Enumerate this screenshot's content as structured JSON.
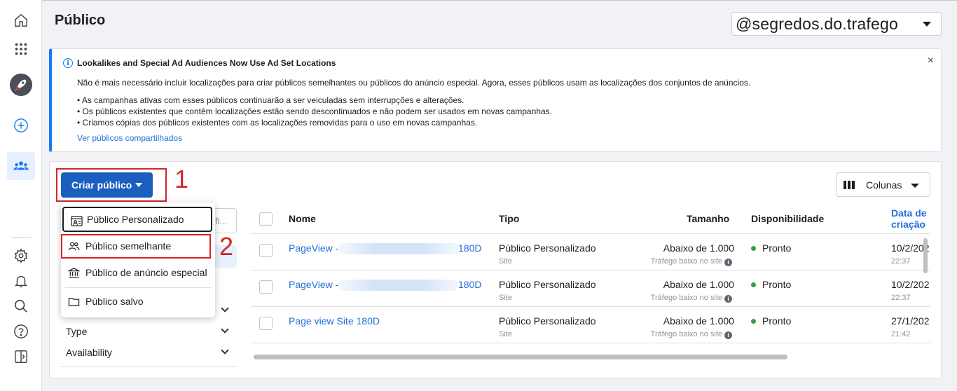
{
  "page": {
    "title": "Público"
  },
  "account": {
    "name": "@segredos.do.trafego"
  },
  "sidebar": {
    "icons": [
      "home-icon",
      "apps-grid-icon",
      "rocket-icon",
      "add-circle-icon",
      "audiences-icon",
      "settings-icon",
      "bell-icon",
      "search-icon",
      "help-icon",
      "panel-toggle-icon"
    ]
  },
  "banner": {
    "title": "Lookalikes and Special Ad Audiences Now Use Ad Set Locations",
    "description": "Não é mais necessário incluir localizações para criar públicos semelhantes ou públicos do anúncio especial. Agora, esses públicos usam as localizações dos conjuntos de anúncios.",
    "bullets": [
      "As campanhas ativas com esses públicos continuarão a ser veiculadas sem interrupções e alterações.",
      "Os públicos existentes que contêm localizações estão sendo descontinuados e não podem ser usados em novas campanhas.",
      "Criamos cópias dos públicos existentes com as localizações removidas para o uso em novas campanhas."
    ],
    "link": "Ver públicos compartilhados",
    "close": "×"
  },
  "toolbar": {
    "create_label": "Criar público",
    "columns_label": "Colunas"
  },
  "annotations": {
    "one": "1",
    "two": "2"
  },
  "menu": {
    "items": [
      {
        "label": "Público Personalizado",
        "icon": "custom-audience-icon"
      },
      {
        "label": "Público semelhante",
        "icon": "lookalike-audience-icon"
      },
      {
        "label": "Público de anúncio especial",
        "icon": "bank-icon"
      },
      {
        "label": "Público salvo",
        "icon": "folder-icon"
      }
    ]
  },
  "filters": {
    "search_placeholder": "fi...",
    "type_label": "Type",
    "availability_label": "Availability"
  },
  "table": {
    "headers": {
      "name": "Nome",
      "type": "Tipo",
      "size": "Tamanho",
      "availability": "Disponibilidade",
      "date_line1": "Data de",
      "date_line2": "criação"
    },
    "rows": [
      {
        "name_prefix": "PageView - ",
        "name_suffix": "180D",
        "type": "Público Personalizado",
        "source": "Site",
        "size": "Abaixo de 1.000",
        "size_note": "Tráfego baixo no site",
        "status": "Pronto",
        "date": "10/2/202",
        "time": "22:37"
      },
      {
        "name_prefix": "PageView - ",
        "name_suffix": "180D",
        "type": "Público Personalizado",
        "source": "Site",
        "size": "Abaixo de 1.000",
        "size_note": "Tráfego baixo no site",
        "status": "Pronto",
        "date": "10/2/202",
        "time": "22:37"
      },
      {
        "name_prefix": "Page view Site 180D",
        "name_suffix": "",
        "type": "Público Personalizado",
        "source": "Site",
        "size": "Abaixo de 1.000",
        "size_note": "Tráfego baixo no site",
        "status": "Pronto",
        "date": "27/1/202",
        "time": "21:42"
      }
    ]
  },
  "colors": {
    "accent": "#1877f2",
    "primary_button": "#1a5fbf",
    "annotation": "#d4262b",
    "status_ready": "#31a24c"
  }
}
